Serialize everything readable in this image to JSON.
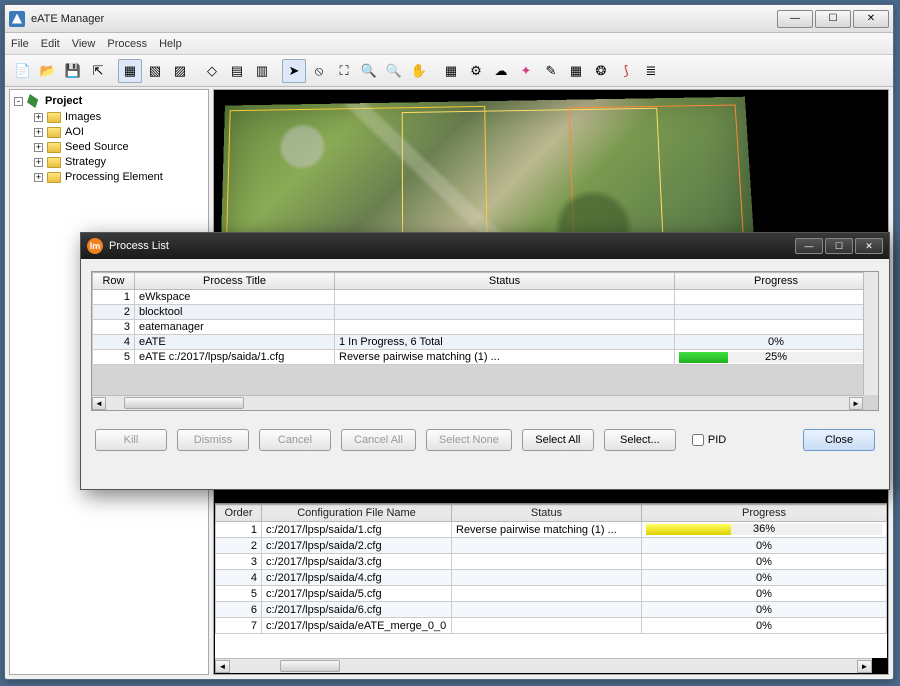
{
  "window": {
    "title": "eATE Manager"
  },
  "menu": {
    "file": "File",
    "edit": "Edit",
    "view": "View",
    "process": "Process",
    "help": "Help"
  },
  "tree": {
    "root": "Project",
    "items": [
      "Images",
      "AOI",
      "Seed Source",
      "Strategy",
      "Processing Element"
    ]
  },
  "dialog": {
    "title": "Process List",
    "headers": {
      "row": "Row",
      "ptitle": "Process Title",
      "status": "Status",
      "progress": "Progress"
    },
    "rows": [
      {
        "n": "1",
        "title": "eWkspace",
        "status": "",
        "progress": ""
      },
      {
        "n": "2",
        "title": "blocktool",
        "status": "",
        "progress": ""
      },
      {
        "n": "3",
        "title": "eatemanager",
        "status": "",
        "progress": ""
      },
      {
        "n": "4",
        "title": "eATE",
        "status": "1 In Progress, 6 Total",
        "progress": "0%"
      },
      {
        "n": "5",
        "title": "eATE c:/2017/lpsp/saida/1.cfg",
        "status": "Reverse pairwise matching (1) ...",
        "progress": "25%"
      }
    ],
    "buttons": {
      "kill": "Kill",
      "dismiss": "Dismiss",
      "cancel": "Cancel",
      "cancel_all": "Cancel All",
      "select_none": "Select None",
      "select_all": "Select All",
      "select": "Select...",
      "pid": "PID",
      "close": "Close"
    }
  },
  "config_table": {
    "headers": {
      "order": "Order",
      "cfg": "Configuration File Name",
      "status": "Status",
      "progress": "Progress"
    },
    "rows": [
      {
        "n": "1",
        "cfg": "c:/2017/lpsp/saida/1.cfg",
        "status": "Reverse pairwise matching (1) ...",
        "progress": "36%"
      },
      {
        "n": "2",
        "cfg": "c:/2017/lpsp/saida/2.cfg",
        "status": "",
        "progress": "0%"
      },
      {
        "n": "3",
        "cfg": "c:/2017/lpsp/saida/3.cfg",
        "status": "",
        "progress": "0%"
      },
      {
        "n": "4",
        "cfg": "c:/2017/lpsp/saida/4.cfg",
        "status": "",
        "progress": "0%"
      },
      {
        "n": "5",
        "cfg": "c:/2017/lpsp/saida/5.cfg",
        "status": "",
        "progress": "0%"
      },
      {
        "n": "6",
        "cfg": "c:/2017/lpsp/saida/6.cfg",
        "status": "",
        "progress": "0%"
      },
      {
        "n": "7",
        "cfg": "c:/2017/lpsp/saida/eATE_merge_0_0",
        "status": "",
        "progress": "0%"
      }
    ]
  }
}
